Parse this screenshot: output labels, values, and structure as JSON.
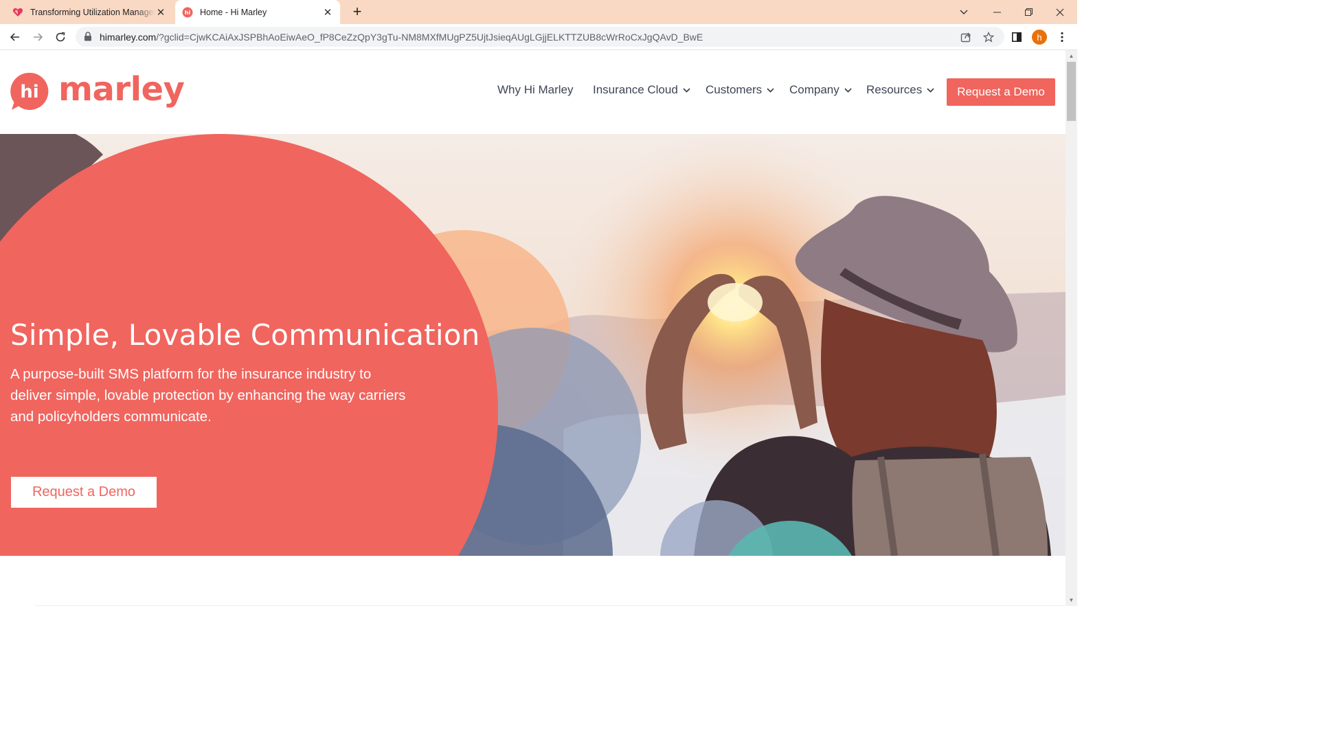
{
  "browser": {
    "tabs": [
      {
        "title": "Transforming Utilization Management",
        "favicon": "heart-icon",
        "active": false
      },
      {
        "title": "Home - Hi Marley",
        "favicon": "hi-marley-icon",
        "active": true
      }
    ],
    "url_host": "himarley.com",
    "url_rest": "/?gclid=CjwKCAiAxJSPBhAoEiwAeO_fP8CeZzQpY3gTu-NM8MXfMUgPZ5UjtJsieqAUgLGjjELKTTZUB8cWrRoCxJgQAvD_BwE",
    "profile_initial": "h"
  },
  "site": {
    "logo_text": "marley",
    "logo_bubble_text": "hi",
    "nav": [
      {
        "label": "Why Hi Marley",
        "has_dropdown": false
      },
      {
        "label": "Insurance Cloud",
        "has_dropdown": true
      },
      {
        "label": "Customers",
        "has_dropdown": true
      },
      {
        "label": "Company",
        "has_dropdown": true
      },
      {
        "label": "Resources",
        "has_dropdown": true
      }
    ],
    "cta_label": "Request a Demo",
    "brand_color": "#f0655e"
  },
  "hero": {
    "title": "Simple, Lovable Communication",
    "text": "A purpose-built SMS platform for the insurance industry to deliver simple, lovable protection by enhancing the way carriers and policyholders communicate.",
    "cta_label": "Request a Demo"
  }
}
